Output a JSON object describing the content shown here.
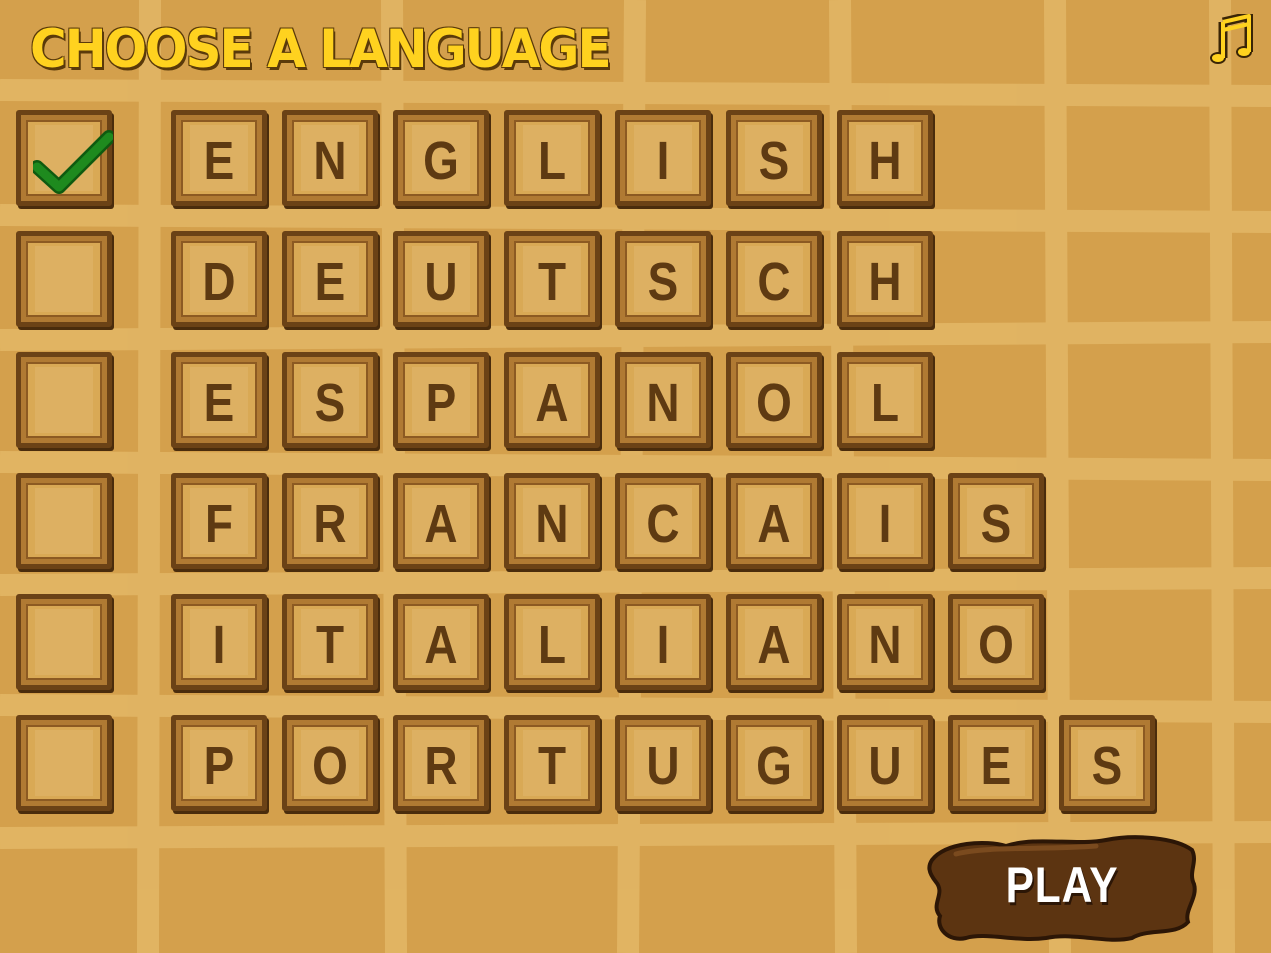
{
  "title": "CHOOSE A LANGUAGE",
  "music_icon": "music-note-icon",
  "check_icon": "checkmark-icon",
  "play_label": "PLAY",
  "colors": {
    "background": "#d4a04c",
    "grid": "#e2b665",
    "title": "#ffd21f",
    "tile_border": "#6b4216",
    "letter": "#5e3a12",
    "check": "#1e8a1e",
    "play_button": "#5c3411"
  },
  "languages": [
    {
      "name": "ENGLISH",
      "letters": [
        "E",
        "N",
        "G",
        "L",
        "I",
        "S",
        "H"
      ],
      "selected": true
    },
    {
      "name": "DEUTSCH",
      "letters": [
        "D",
        "E",
        "U",
        "T",
        "S",
        "C",
        "H"
      ],
      "selected": false
    },
    {
      "name": "ESPANOL",
      "letters": [
        "E",
        "S",
        "P",
        "A",
        "N",
        "O",
        "L"
      ],
      "selected": false
    },
    {
      "name": "FRANCAIS",
      "letters": [
        "F",
        "R",
        "A",
        "N",
        "C",
        "A",
        "I",
        "S"
      ],
      "selected": false
    },
    {
      "name": "ITALIANO",
      "letters": [
        "I",
        "T",
        "A",
        "L",
        "I",
        "A",
        "N",
        "O"
      ],
      "selected": false
    },
    {
      "name": "PORTUGUES",
      "letters": [
        "P",
        "O",
        "R",
        "T",
        "U",
        "G",
        "U",
        "E",
        "S"
      ],
      "selected": false
    }
  ]
}
